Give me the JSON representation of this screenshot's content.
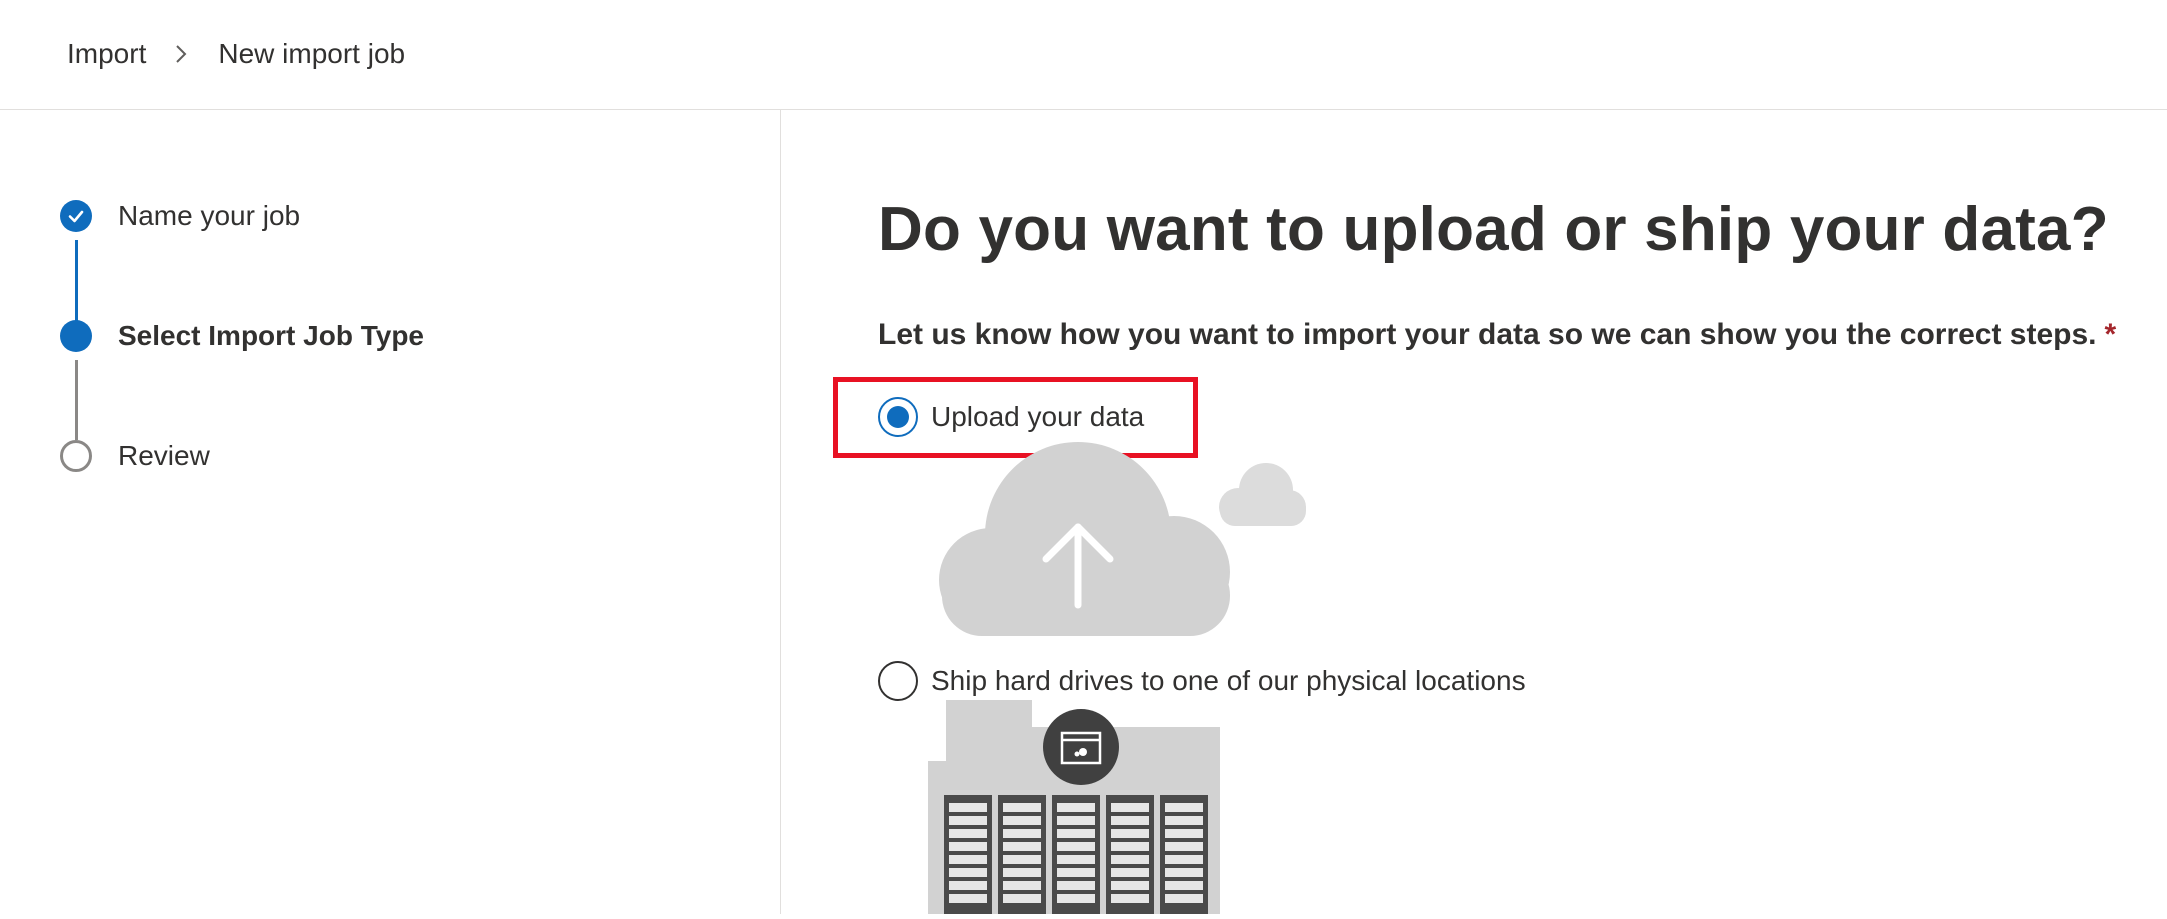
{
  "breadcrumb": {
    "root": "Import",
    "current": "New import job"
  },
  "wizard": {
    "steps": [
      {
        "label": "Name your job",
        "status": "completed"
      },
      {
        "label": "Select Import Job Type",
        "status": "current"
      },
      {
        "label": "Review",
        "status": "pending"
      }
    ]
  },
  "main": {
    "title": "Do you want to upload or ship your data?",
    "prompt": "Let us know how you want to import your data so we can show you the correct steps.",
    "required_marker": "*",
    "options": [
      {
        "label": "Upload your data",
        "selected": true,
        "illustration": "cloud-upload-illustration"
      },
      {
        "label": "Ship hard drives to one of our physical locations",
        "selected": false,
        "illustration": "datacenter-illustration"
      }
    ]
  },
  "colors": {
    "accent": "#0f6cbd",
    "highlight": "#e81123",
    "required": "#a4262c",
    "illustration_gray": "#d2d2d2",
    "server_dark": "#4a4a4a"
  }
}
